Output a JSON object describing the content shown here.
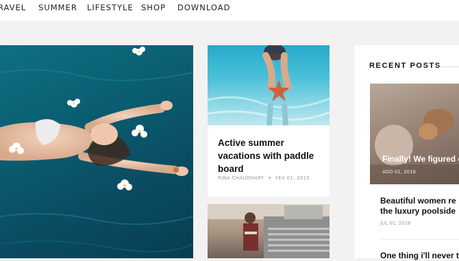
{
  "nav": {
    "items": [
      "RAVEL",
      "SUMMER",
      "LIFESTYLE",
      "SHOP",
      "DOWNLOAD"
    ]
  },
  "posts": [
    {
      "title": "Active summer vacations with paddle board",
      "author": "RINA CHAUDHARY",
      "date": "FEV 01, 2015"
    }
  ],
  "sidebar": {
    "heading": "RECENT POSTS",
    "featured": {
      "title": "Finally! We figured o",
      "date": "AGO 01, 2016"
    },
    "items": [
      {
        "title_line1": "Beautiful women re",
        "title_line2": "the luxury poolside",
        "date": "JUL 01, 2016"
      },
      {
        "title_line1": "One thing i'll never t",
        "title_line2": "",
        "date": ""
      }
    ]
  },
  "colors": {
    "accent": "#c55555",
    "pool": "#0b5e72"
  }
}
